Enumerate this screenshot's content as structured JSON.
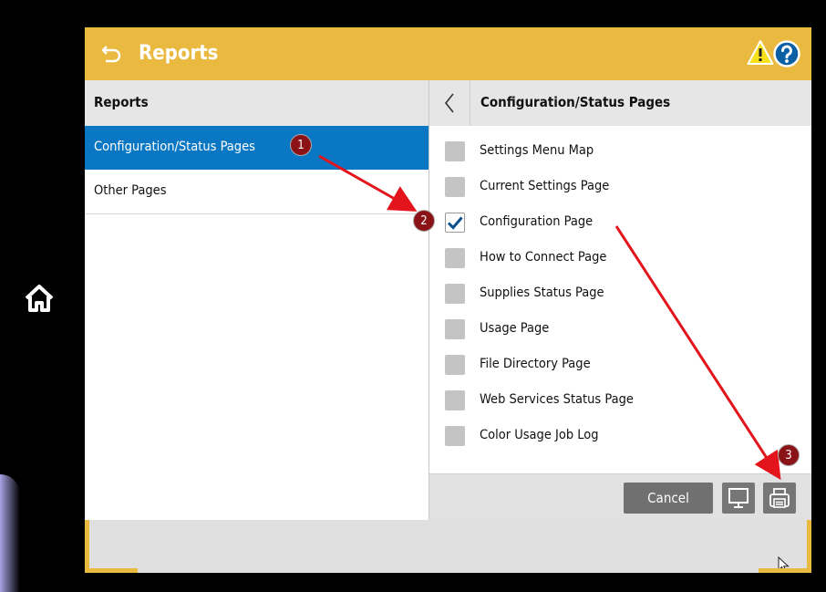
{
  "header": {
    "title": "Reports"
  },
  "left_panel": {
    "title": "Reports",
    "items": [
      {
        "label": "Configuration/Status Pages",
        "selected": true
      },
      {
        "label": "Other Pages",
        "selected": false
      }
    ]
  },
  "right_panel": {
    "title": "Configuration/Status Pages",
    "options": [
      {
        "label": "Settings Menu Map",
        "checked": false
      },
      {
        "label": "Current Settings Page",
        "checked": false
      },
      {
        "label": "Configuration Page",
        "checked": true
      },
      {
        "label": "How to Connect Page",
        "checked": false
      },
      {
        "label": "Supplies Status Page",
        "checked": false
      },
      {
        "label": "Usage Page",
        "checked": false
      },
      {
        "label": "File Directory Page",
        "checked": false
      },
      {
        "label": "Web Services Status Page",
        "checked": false
      },
      {
        "label": "Color Usage Job Log",
        "checked": false
      }
    ]
  },
  "actions": {
    "cancel_label": "Cancel"
  },
  "annotations": [
    "1",
    "2",
    "3"
  ],
  "colors": {
    "accent": "#e9b940",
    "selected": "#0a77c4",
    "annotation": "#8b1217",
    "arrow": "#e3141b"
  }
}
